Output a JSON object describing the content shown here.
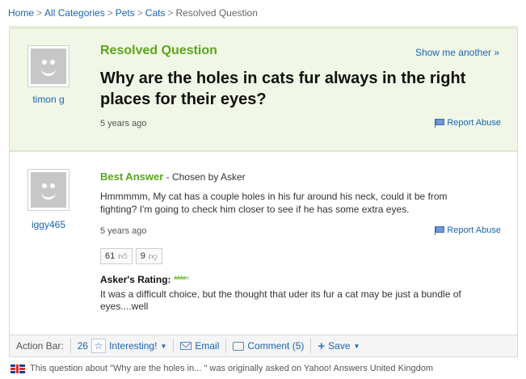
{
  "breadcrumb": {
    "home": "Home",
    "all_categories": "All Categories",
    "pets": "Pets",
    "cats": "Cats",
    "current": "Resolved Question",
    "separator": ">"
  },
  "question": {
    "heading": "Resolved Question",
    "show_another": "Show me another »",
    "title": "Why are the holes in cats fur always in the right places for their eyes?",
    "asker": "timon g",
    "time_ago": "5 years ago",
    "report": "Report Abuse"
  },
  "answer": {
    "label": "Best Answer",
    "chosen_by": " - Chosen by Asker",
    "text": "Hmmmmm, My cat has a couple holes in his fur around his neck, could it be from fighting? I'm going to check him closer to see if he has some extra eyes.",
    "answerer": "iggy465",
    "time_ago": "5 years ago",
    "report": "Report Abuse",
    "thumbs_up": "61",
    "thumbs_down": "9"
  },
  "asker_rating": {
    "label": "Asker's Rating:",
    "filled_stars": "****",
    "empty_stars": "*",
    "rating_value": 4,
    "rating_max": 5,
    "comment": "It was a difficult choice, but the thought that uder its fur a cat may be just a bundle of eyes....well"
  },
  "action_bar": {
    "label": "Action Bar:",
    "interesting_count": "26",
    "interesting": "Interesting!",
    "email": "Email",
    "comment": "Comment (5)",
    "save": "Save"
  },
  "footnote": {
    "text": "This question about \"Why are the holes in... \" was originally asked on Yahoo! Answers United Kingdom"
  },
  "colors": {
    "accent_green": "#5aa61d",
    "link_blue": "#1a64b4",
    "question_bg": "#f1f7e6"
  }
}
